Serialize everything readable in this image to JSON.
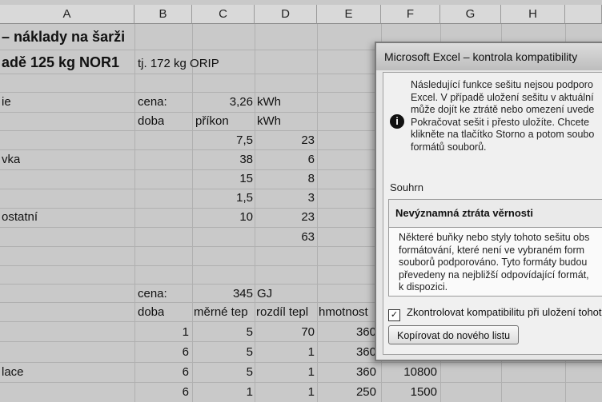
{
  "columns": [
    "A",
    "B",
    "C",
    "D",
    "E",
    "F",
    "G",
    "H"
  ],
  "cells": {
    "title1": "– náklady na šarži",
    "title2": "adě 125 kg NOR1",
    "tj": "tj. 172 kg ORIP",
    "r4a": "ie",
    "r4b": "cena:",
    "r4c": "3,26",
    "r4d": "kWh",
    "r5b": "doba",
    "r5c": "příkon",
    "r5d": "kWh",
    "r6c": "7,5",
    "r6d": "23",
    "r7a": "vka",
    "r7c": "38",
    "r7d": "6",
    "r8c": "15",
    "r8d": "8",
    "r9c": "1,5",
    "r9d": "3",
    "r10a": "ostatní",
    "r10c": "10",
    "r10d": "23",
    "r11d": "63",
    "r14b": "cena:",
    "r14c": "345",
    "r14d": "GJ",
    "r15b": "doba",
    "r15c": "měrné tep",
    "r15d": "rozdíl tepl",
    "r15e": "hmotnost",
    "r16b": "1",
    "r16c": "5",
    "r16d": "70",
    "r16e": "360",
    "r17b": "6",
    "r17c": "5",
    "r17d": "1",
    "r17e": "360",
    "r18a": "lace",
    "r18b": "6",
    "r18c": "5",
    "r18d": "1",
    "r18e": "360",
    "r18f": "10800",
    "r19b": "6",
    "r19c": "1",
    "r19d": "1",
    "r19e": "250",
    "r19f": "1500"
  },
  "dialog": {
    "title": "Microsoft Excel – kontrola kompatibility",
    "message": [
      "Následující funkce sešitu nejsou podporo",
      "Excel. V případě uložení sešitu v aktuální",
      "může dojít ke ztrátě nebo omezení uvede",
      "Pokračovat sešit i přesto uložíte. Chcete",
      "klikněte na tlačítko Storno a potom soubo",
      "formátů souborů."
    ],
    "summary_label": "Souhrn",
    "summary_heading": "Nevýznamná ztráta věrnosti",
    "summary_text": [
      "Některé buňky nebo styly tohoto sešitu obs",
      "formátování, které není ve vybraném form",
      "souborů podporováno. Tyto formáty budou",
      "převedeny na nejbližší odpovídající formát,",
      "k dispozici."
    ],
    "checkbox_label": "Zkontrolovat kompatibilitu při uložení tohoto",
    "checkbox_checked": true,
    "copy_button": "Kopírovat do nového listu",
    "icon": "info-icon"
  }
}
